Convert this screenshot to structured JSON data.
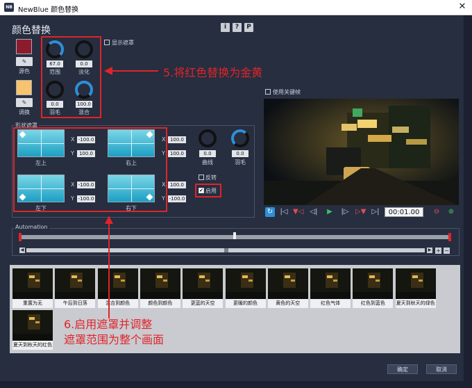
{
  "window": {
    "icon_text": "NB",
    "title": "NewBlue 颜色替换",
    "close": "✕"
  },
  "header": {
    "title": "颜色替换",
    "buttons": [
      "i",
      "?",
      "P"
    ]
  },
  "color_panel": {
    "source_label": "源色",
    "target_label": "调换",
    "source_color": "#8c1c2c",
    "target_color": "#f7c46e",
    "picker_icon": "eyedropper-icon"
  },
  "knobs": [
    {
      "label": "范围",
      "value": "67.0"
    },
    {
      "label": "淡化",
      "value": "0.0"
    },
    {
      "label": "羽毛",
      "value": "0.0"
    },
    {
      "label": "混合",
      "value": "100.0"
    }
  ],
  "show_mask_label": "显示遮罩",
  "annotation1": "5.将红色替换为金黄",
  "annotation2": "6.启用遮罩并调整\n遮罩范围为整个画面",
  "shape_mask": {
    "title": "形状遮罩",
    "pads": [
      {
        "label": "左上",
        "x": "-100.0",
        "y": "100.0"
      },
      {
        "label": "右上",
        "x": "100.0",
        "y": "100.0"
      },
      {
        "label": "左下",
        "x": "-100.0",
        "y": "-100.0"
      },
      {
        "label": "右下",
        "x": "100.0",
        "y": "-100.0"
      }
    ],
    "curve": {
      "label": "曲线",
      "value": "0.0"
    },
    "feather": {
      "label": "羽毛",
      "value": "0.0"
    },
    "invert_label": "反转",
    "enable_label": "启用",
    "enable_checked": "✔"
  },
  "keyframe_label": "使用关键帧",
  "transport": {
    "timecode": "00:01.00"
  },
  "automation": {
    "title": "Automation"
  },
  "presets": [
    "重置为无",
    "午后到日落",
    "混合到颜色",
    "颜色到颜色",
    "更蓝的天空",
    "更暖的颜色",
    "黄色的天空",
    "红色气体",
    "红色到蓝色",
    "夏天到秋天的绿色",
    "夏天到秋天的红色"
  ],
  "footer": {
    "ok": "确定",
    "cancel": "取消"
  },
  "colors": {
    "dialog_bg": "#262e3f",
    "annotation_red": "#e0242a",
    "accent_blue": "#2f8fd8"
  }
}
